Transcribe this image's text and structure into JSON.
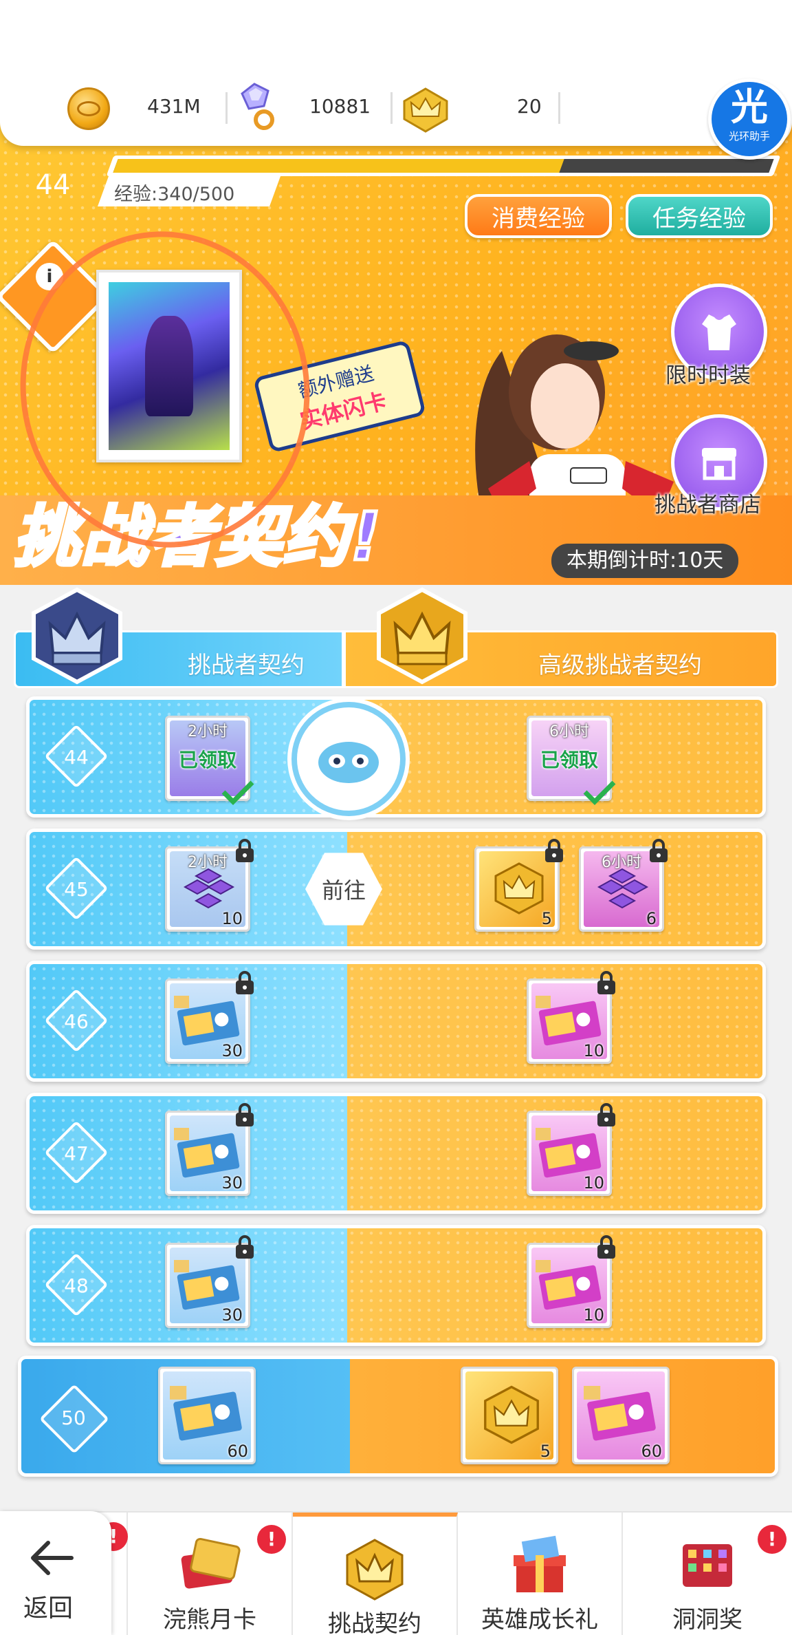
{
  "currency": {
    "gold": "431M",
    "gems": "10881",
    "crowns": "20"
  },
  "halo_badge": {
    "glyph": "光",
    "label": "光环助手"
  },
  "banner": {
    "level": "44",
    "xp_label": "经验:340/500",
    "xp_progress": 0.68,
    "btn_consume": "消费经验",
    "btn_task": "任务经验",
    "limited_outfit": "限时时装",
    "challenger_shop": "挑战者商店",
    "gift_line1": "额外赠送",
    "gift_line2": "实体闪卡",
    "title": "挑战者契约!",
    "countdown": "本期倒计时:10天",
    "info_glyph": "i"
  },
  "track": {
    "free_label": "挑战者契约",
    "premium_label": "高级挑战者契约",
    "goto_label": "前往",
    "claimed_label": "已领取"
  },
  "rows": [
    {
      "level": "44",
      "free": {
        "hrs": "2小时",
        "claimed": true
      },
      "premium": {
        "hrs": "6小时",
        "claimed": true
      }
    },
    {
      "level": "45",
      "free": {
        "hrs": "2小时",
        "qty": "10"
      },
      "premium_crown": {
        "qty": "5"
      },
      "premium": {
        "hrs": "6小时",
        "qty": "6"
      }
    },
    {
      "level": "46",
      "free": {
        "qty": "30"
      },
      "premium": {
        "qty": "10"
      }
    },
    {
      "level": "47",
      "free": {
        "qty": "30"
      },
      "premium": {
        "qty": "10"
      }
    },
    {
      "level": "48",
      "free": {
        "qty": "30"
      },
      "premium": {
        "qty": "10"
      }
    },
    {
      "level": "50",
      "free": {
        "qty": "60"
      },
      "premium_crown": {
        "qty": "5"
      },
      "premium": {
        "qty": "60"
      }
    }
  ],
  "nav": {
    "back": "返回",
    "tabs": [
      {
        "label": "浣熊月卡",
        "alert": "!"
      },
      {
        "label": "挑战契约",
        "active": true
      },
      {
        "label": "英雄成长礼"
      },
      {
        "label": "洞洞奖",
        "alert": "!"
      }
    ],
    "back_alert": "!"
  },
  "icons": [
    "gold-coin-icon",
    "gem-ring-icon",
    "crown-icon",
    "lock-icon",
    "check-icon",
    "coupon-icon",
    "gem-cube-icon",
    "shirt-icon",
    "shop-icon",
    "back-arrow-icon"
  ],
  "colors": {
    "free_track": "#52c9f7",
    "premium_track": "#ffbd3f",
    "accent": "#ff9722",
    "claimed": "#19a34a"
  }
}
